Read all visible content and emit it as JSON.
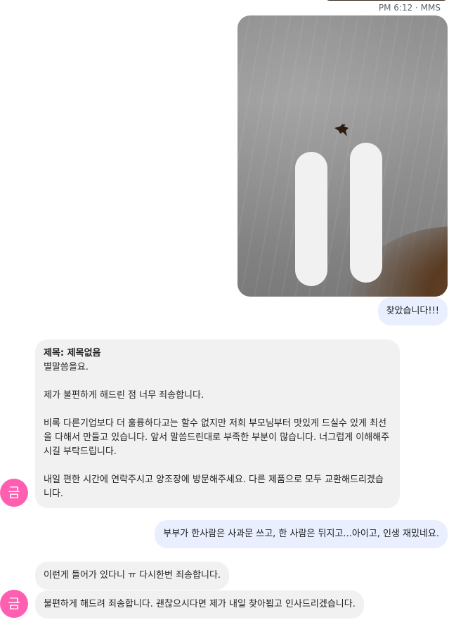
{
  "meta": {
    "time_service": "PM 6:12 · MMS"
  },
  "messages": {
    "out_1": "찾았습니다!!!",
    "in_1_subject": "제목: 제목없음",
    "in_1_body": "별말씀을요.\n\n제가 불편하게 해드린 점 너무 죄송합니다.\n\n비록 다른기업보다 더 훌륭하다고는 할수 없지만 저희 부모님부터 맛있게 드실수 있게 최선을 다해서 만들고 있습니다. 앞서 말씀드린대로 부족한 부분이 많습니다. 너그럽게 이해해주시길 부탁드립니다.\n\n내일 편한 시간에 연락주시고 양조장에 방문해주세요. 다른 제품으로 모두 교환해드리겠습니다.",
    "out_2": "부부가 한사람은 사과문 쓰고, 한 사람은 뒤지고...아이고, 인생 재밌네요.",
    "in_2": "이런게 들어가 있다니 ㅠ 다시한번 죄송합니다.",
    "in_3": "불편하게 해드려 죄송합니다. 괜찮으시다면 제가 내일 찾아뵙고 인사드리겠습니다."
  },
  "avatar": {
    "initial": "금",
    "color": "#ff5fb0"
  },
  "colors": {
    "outgoing_bubble": "#e9efff",
    "incoming_bubble": "#f1f1f1"
  },
  "icons": [
    "photo-attachment",
    "contact-avatar"
  ]
}
